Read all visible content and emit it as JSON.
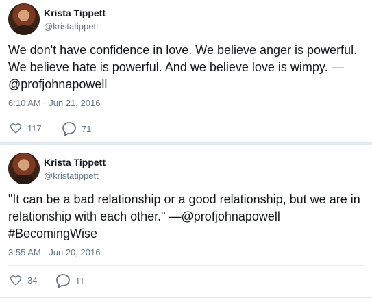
{
  "tweets": [
    {
      "author_name": "Krista Tippett",
      "handle": "@kristatippett",
      "text": "We don't have confidence in love. We believe anger is powerful. We believe hate is powerful. And we believe love is wimpy. —@profjohnapowell",
      "timestamp": "6:10 AM · Jun 21, 2016",
      "likes": "117",
      "replies": "71"
    },
    {
      "author_name": "Krista Tippett",
      "handle": "@kristatippett",
      "text": "\"It can be a bad relationship or a good relationship, but we are in relationship with each other.\" —@profjohnapowell #BecomingWise",
      "timestamp": "3:55 AM · Jun 20, 2016",
      "likes": "34",
      "replies": "11"
    }
  ],
  "icons": {
    "like": "heart-outline-icon",
    "reply": "speech-bubble-icon"
  },
  "colors": {
    "text": "#14171a",
    "secondary": "#657786",
    "background": "#e6ecf0"
  }
}
